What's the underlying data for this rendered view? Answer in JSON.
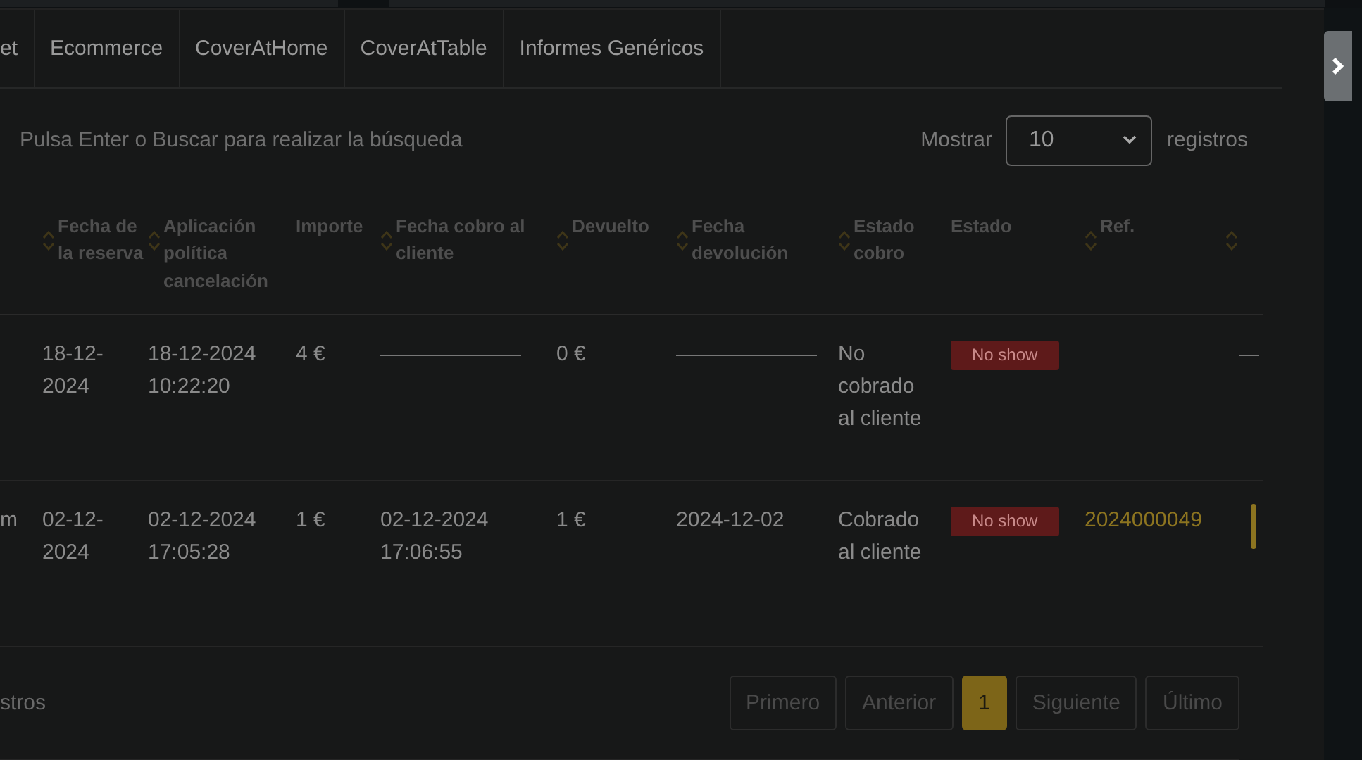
{
  "tabs": [
    {
      "label": "et"
    },
    {
      "label": "Ecommerce"
    },
    {
      "label": "CoverAtHome"
    },
    {
      "label": "CoverAtTable"
    },
    {
      "label": "Informes Genéricos"
    }
  ],
  "search": {
    "hint": "Pulsa Enter o Buscar para realizar la búsqueda"
  },
  "page_size": {
    "label": "Mostrar",
    "value": "10",
    "suffix": "registros"
  },
  "table": {
    "columns": [
      {
        "sortable": false
      },
      {
        "label": "Fecha de la reserva",
        "sortable": true
      },
      {
        "label": "Aplicación política cancelación",
        "sortable": true
      },
      {
        "label": "Importe",
        "sortable": false
      },
      {
        "label": "Fecha cobro al cliente",
        "sortable": true
      },
      {
        "label": "Devuelto",
        "sortable": true
      },
      {
        "label": "Fecha devolución",
        "sortable": true
      },
      {
        "label": "Estado cobro",
        "sortable": true
      },
      {
        "label": "Estado",
        "sortable": false
      },
      {
        "label": "Ref.",
        "sortable": true
      },
      {
        "sortable": true
      }
    ],
    "rows": [
      {
        "cells": [
          {
            "kind": "blank_cell"
          },
          {
            "kind": "text",
            "text": "18-12-2024"
          },
          {
            "kind": "text",
            "text": "18-12-2024 10:22:20"
          },
          {
            "kind": "text",
            "text": "4 €"
          },
          {
            "kind": "line"
          },
          {
            "kind": "text",
            "text": "0 €"
          },
          {
            "kind": "line"
          },
          {
            "kind": "text",
            "text": "No cobrado al cliente"
          },
          {
            "kind": "badge",
            "text": "No show"
          },
          {
            "kind": "blank_cell"
          },
          {
            "kind": "dash"
          }
        ]
      },
      {
        "cells": [
          {
            "kind": "text",
            "text": "m"
          },
          {
            "kind": "text",
            "text": "02-12-2024"
          },
          {
            "kind": "text",
            "text": "02-12-2024 17:05:28"
          },
          {
            "kind": "text",
            "text": "1 €"
          },
          {
            "kind": "text",
            "text": "02-12-2024 17:06:55"
          },
          {
            "kind": "text",
            "text": "1 €"
          },
          {
            "kind": "text",
            "text": "2024-12-02"
          },
          {
            "kind": "text",
            "text": "Cobrado al cliente"
          },
          {
            "kind": "badge",
            "text": "No show"
          },
          {
            "kind": "link",
            "text": "2024000049"
          },
          {
            "kind": "action"
          }
        ]
      }
    ]
  },
  "footer": {
    "info": "stros",
    "pages": [
      {
        "label": "Primero",
        "selected": false
      },
      {
        "label": "Anterior",
        "selected": false
      },
      {
        "label": "1",
        "selected": true
      },
      {
        "label": "Siguiente",
        "selected": false
      },
      {
        "label": "Último",
        "selected": false
      }
    ]
  }
}
